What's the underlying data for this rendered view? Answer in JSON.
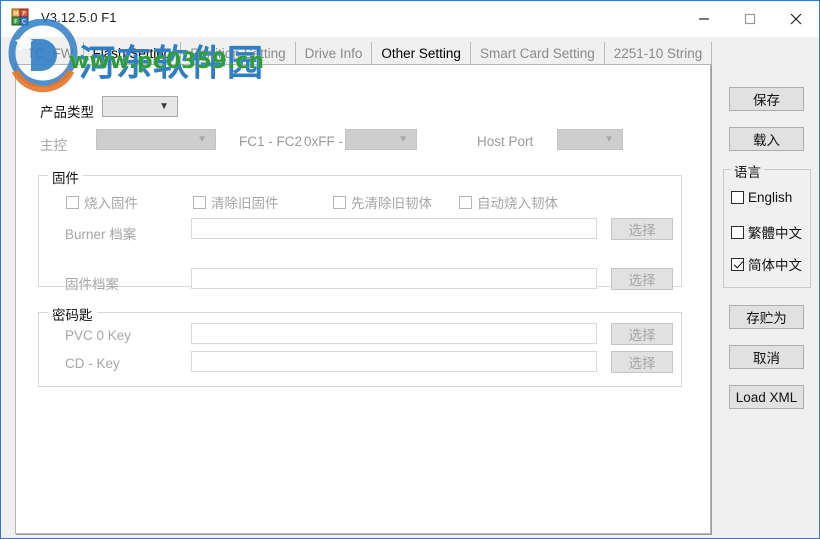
{
  "window": {
    "title": "V3.12.5.0 F1",
    "icon": "chip-fw-icon",
    "controls": {
      "minimize": "minimize-icon",
      "maximize": "maximize-icon",
      "close": "close-icon"
    }
  },
  "watermark": {
    "brand_cn": "河东软件园",
    "url": "www.pc0359.cn",
    "logo": "circle-logo-icon"
  },
  "tabs": [
    {
      "label": "TC_FW",
      "active": false
    },
    {
      "label": "Flash Setting",
      "active": false
    },
    {
      "label": "Partition Setting",
      "active": false
    },
    {
      "label": "Drive Info",
      "active": false
    },
    {
      "label": "Other Setting",
      "active": true
    },
    {
      "label": "Smart Card Setting",
      "active": false
    },
    {
      "label": "2251-10 String",
      "active": false
    }
  ],
  "other_setting": {
    "product_type_label": "产品类型",
    "product_type_value": "",
    "controller_label": "主控",
    "controller_value": "",
    "fc_label": "FC1 - FC2",
    "fc_value_label": "0xFF -",
    "fc_value": "",
    "host_port_label": "Host Port",
    "host_port_value": "",
    "firmware": {
      "group_title": "固件",
      "checkboxes": [
        {
          "label": "烧入固件",
          "checked": false
        },
        {
          "label": "清除旧固件",
          "checked": false
        },
        {
          "label": "先清除旧韧体",
          "checked": false
        },
        {
          "label": "自动烧入韧体",
          "checked": false
        }
      ],
      "burner_file_label": "Burner 档案",
      "burner_file_value": "",
      "burner_browse_label": "选择",
      "firmware_file_label": "固件档案",
      "firmware_file_value": "",
      "firmware_browse_label": "选择"
    },
    "password_key": {
      "group_title": "密码匙",
      "pvc0_label": "PVC 0 Key",
      "pvc0_value": "",
      "pvc0_browse_label": "选择",
      "cd_label": "CD - Key",
      "cd_value": "",
      "cd_browse_label": "选择"
    }
  },
  "sidebar": {
    "save_label": "保存",
    "load_label": "载入",
    "language": {
      "group_title": "语言",
      "options": [
        {
          "label": "English",
          "checked": false
        },
        {
          "label": "繁體中文",
          "checked": false
        },
        {
          "label": "简体中文",
          "checked": true
        }
      ]
    },
    "save_as_label": "存贮为",
    "cancel_label": "取消",
    "load_xml_label": "Load XML"
  },
  "colors": {
    "window_border": "#2b7cd3",
    "panel_bg": "#f0f0f0",
    "tabpage_bg": "#ffffff",
    "button_bg": "#e1e1e1",
    "disabled_text": "#a6a6a6",
    "watermark_blue": "#2f7ec4",
    "watermark_green": "#2f9c3a"
  }
}
